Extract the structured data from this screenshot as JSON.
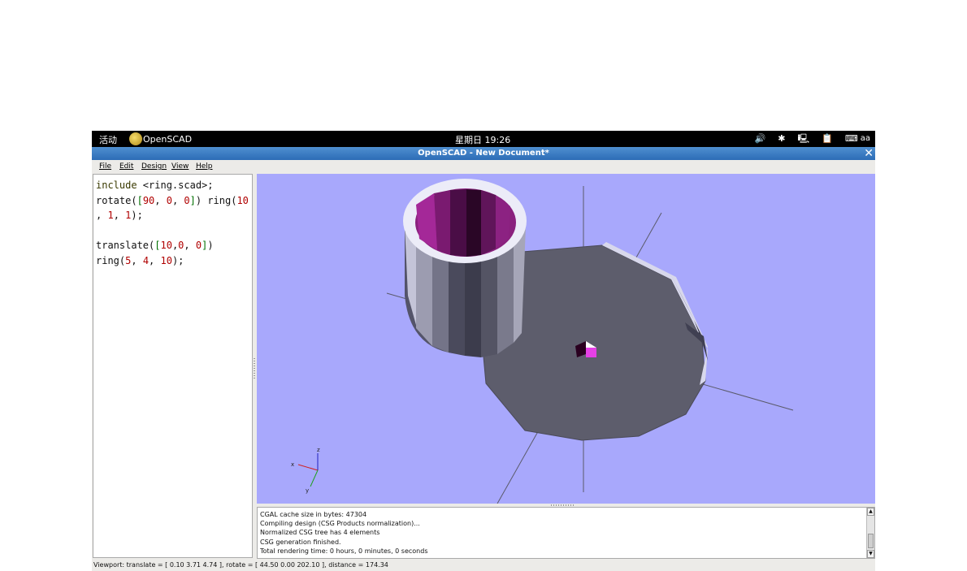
{
  "top_panel": {
    "activities": "活动",
    "app_name": "OpenSCAD",
    "clock": "星期日 19:26",
    "tray": {
      "volume": "🔊",
      "bluetooth": "✱",
      "network": "🖳",
      "clipboard": "📋",
      "keyboard": "⌨",
      "keyboard_label": "aa"
    }
  },
  "window": {
    "title": "OpenSCAD - New Document*",
    "close_glyph": "✕"
  },
  "menu": {
    "file": "File",
    "edit": "Edit",
    "design": "Design",
    "view": "View",
    "help": "Help"
  },
  "editor": {
    "lines": [
      [
        {
          "t": "include ",
          "c": "kw"
        },
        {
          "t": "<ring.scad>;",
          "c": "fn"
        }
      ],
      [
        {
          "t": "rotate(",
          "c": "fn"
        },
        {
          "t": "[",
          "c": "br"
        },
        {
          "t": "90",
          "c": "num"
        },
        {
          "t": ", ",
          "c": "fn"
        },
        {
          "t": "0",
          "c": "num"
        },
        {
          "t": ", ",
          "c": "fn"
        },
        {
          "t": "0",
          "c": "num"
        },
        {
          "t": "]",
          "c": "br"
        },
        {
          "t": ") ring(",
          "c": "fn"
        },
        {
          "t": "10",
          "c": "num"
        }
      ],
      [
        {
          "t": ", ",
          "c": "fn"
        },
        {
          "t": "1",
          "c": "num"
        },
        {
          "t": ", ",
          "c": "fn"
        },
        {
          "t": "1",
          "c": "num"
        },
        {
          "t": ");",
          "c": "fn"
        }
      ],
      [],
      [
        {
          "t": "translate(",
          "c": "fn"
        },
        {
          "t": "[",
          "c": "br"
        },
        {
          "t": "10",
          "c": "num"
        },
        {
          "t": ",",
          "c": "fn"
        },
        {
          "t": "0",
          "c": "num"
        },
        {
          "t": ", ",
          "c": "fn"
        },
        {
          "t": "0",
          "c": "num"
        },
        {
          "t": "]",
          "c": "br"
        },
        {
          "t": ")",
          "c": "fn"
        }
      ],
      [
        {
          "t": "ring(",
          "c": "fn"
        },
        {
          "t": "5",
          "c": "num"
        },
        {
          "t": ", ",
          "c": "fn"
        },
        {
          "t": "4",
          "c": "num"
        },
        {
          "t": ", ",
          "c": "fn"
        },
        {
          "t": "10",
          "c": "num"
        },
        {
          "t": ");",
          "c": "fn"
        }
      ]
    ]
  },
  "viewport": {
    "background": "#a8a8fc",
    "axes_labels": {
      "x": "x",
      "y": "y",
      "z": "z"
    }
  },
  "console": {
    "messages": [
      "CGAL cache size in bytes: 47304",
      "Compiling design (CSG Products normalization)...",
      "Normalized CSG tree has 4 elements",
      "CSG generation finished.",
      "Total rendering time: 0 hours, 0 minutes, 0 seconds"
    ],
    "scroll_up": "▲",
    "scroll_down": "▼"
  },
  "status": {
    "viewport_info": "Viewport: translate = [ 0.10 3.71 4.74 ], rotate = [ 44.50 0.00 202.10 ], distance = 174.34"
  }
}
